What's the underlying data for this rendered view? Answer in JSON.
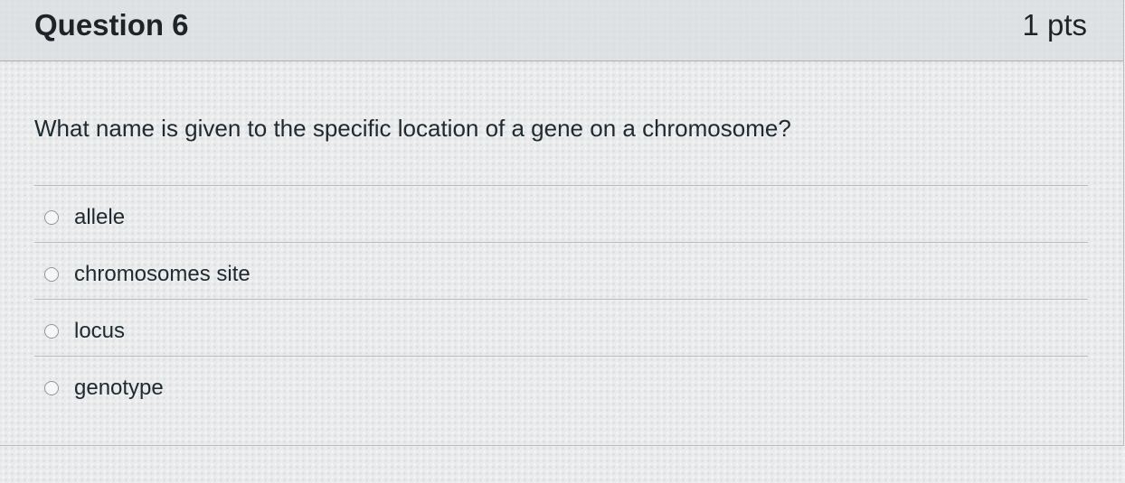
{
  "question": {
    "title": "Question 6",
    "points": "1 pts",
    "text": "What name is given to the specific location of a gene on a chromosome?",
    "answers": [
      {
        "label": "allele"
      },
      {
        "label": "chromosomes site"
      },
      {
        "label": "locus"
      },
      {
        "label": "genotype"
      }
    ]
  },
  "icons": {
    "answer_radio": "radio-button-icon"
  },
  "colors": {
    "header_bg": "#dadee2",
    "text": "#1f2a30",
    "divider": "#b6bcc1"
  }
}
